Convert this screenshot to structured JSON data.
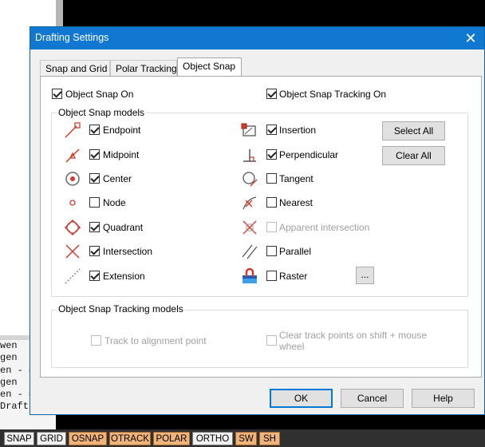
{
  "background": {
    "command_lines": [
      "wen",
      "gen",
      "en - #",
      "gen",
      "en - #",
      "Draft"
    ]
  },
  "status_bar": {
    "buttons": [
      {
        "label": "SNAP",
        "on": false
      },
      {
        "label": "GRID",
        "on": false
      },
      {
        "label": "OSNAP",
        "on": true
      },
      {
        "label": "OTRACK",
        "on": true
      },
      {
        "label": "POLAR",
        "on": true
      },
      {
        "label": "ORTHO",
        "on": false
      },
      {
        "label": "SW",
        "on": true
      },
      {
        "label": "SH",
        "on": true
      }
    ]
  },
  "dialog": {
    "title": "Drafting Settings",
    "close_glyph": "✕",
    "tabs": [
      {
        "label": "Snap and Grid",
        "active": false
      },
      {
        "label": "Polar Tracking",
        "active": false
      },
      {
        "label": "Object Snap",
        "active": true
      }
    ],
    "object_snap_on": {
      "label": "Object Snap On",
      "checked": true
    },
    "object_snap_tracking_on": {
      "label": "Object Snap Tracking On",
      "checked": true
    },
    "snap_models": {
      "group_label": "Object Snap models",
      "left": [
        {
          "label": "Endpoint",
          "checked": true,
          "icon": "endpoint-icon"
        },
        {
          "label": "Midpoint",
          "checked": true,
          "icon": "midpoint-icon"
        },
        {
          "label": "Center",
          "checked": true,
          "icon": "center-icon"
        },
        {
          "label": "Node",
          "checked": false,
          "icon": "node-icon"
        },
        {
          "label": "Quadrant",
          "checked": true,
          "icon": "quadrant-icon"
        },
        {
          "label": "Intersection",
          "checked": true,
          "icon": "intersection-icon"
        },
        {
          "label": "Extension",
          "checked": true,
          "icon": "extension-icon"
        }
      ],
      "right": [
        {
          "label": "Insertion",
          "checked": true,
          "disabled": false,
          "icon": "insertion-icon"
        },
        {
          "label": "Perpendicular",
          "checked": true,
          "disabled": false,
          "icon": "perpendicular-icon"
        },
        {
          "label": "Tangent",
          "checked": false,
          "disabled": false,
          "icon": "tangent-icon"
        },
        {
          "label": "Nearest",
          "checked": false,
          "disabled": false,
          "icon": "nearest-icon"
        },
        {
          "label": "Apparent intersection",
          "checked": false,
          "disabled": true,
          "icon": "apparent-intersection-icon"
        },
        {
          "label": "Parallel",
          "checked": false,
          "disabled": false,
          "icon": "parallel-icon"
        },
        {
          "label": "Raster",
          "checked": false,
          "disabled": false,
          "icon": "raster-icon"
        }
      ],
      "select_all_label": "Select All",
      "clear_all_label": "Clear All",
      "ellipsis_label": "..."
    },
    "tracking_models": {
      "group_label": "Object Snap Tracking models",
      "track_to_alignment": {
        "label": "Track to alignment point",
        "checked": false,
        "disabled": true
      },
      "clear_track_points": {
        "label_line1": "Clear track points on shift + mouse",
        "label_line2": "wheel",
        "checked": false,
        "disabled": true
      }
    },
    "ok_label": "OK",
    "cancel_label": "Cancel",
    "help_label": "Help"
  },
  "colors": {
    "title_bar": "#1178d2",
    "snap_icon_red": "#d43a2a",
    "status_on": "#f0b47a"
  }
}
